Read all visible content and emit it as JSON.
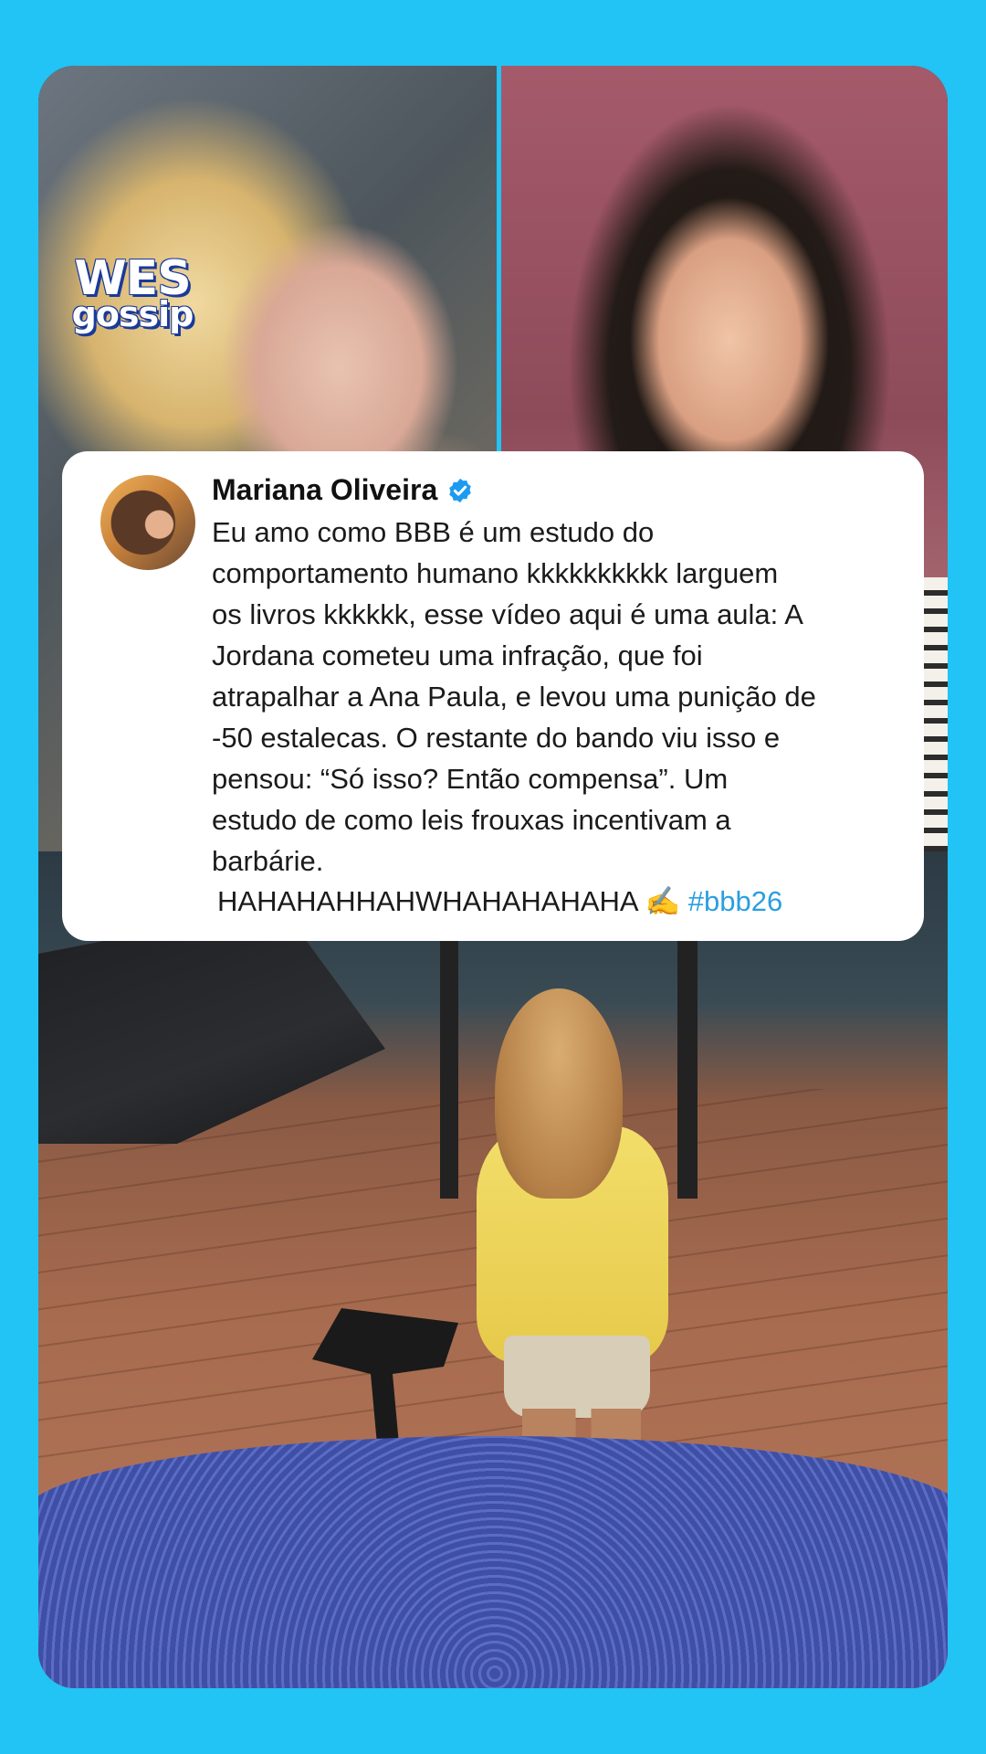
{
  "watermark": {
    "line1": "WES",
    "line2": "gossip"
  },
  "tweet": {
    "author": "Mariana Oliveira",
    "verified": true,
    "body": "Eu amo como BBB é um estudo do\ncomportamento humano kkkkkkkkkk larguem\nos livros kkkkkk, esse vídeo aqui é uma aula: A\nJordana cometeu uma infração, que foi\natrapalhar a Ana Paula, e levou uma punição de\n-50 estalecas. O restante do bando viu isso e\npensou: “Só isso? Então compensa”. Um\nestudo de como leis frouxas incentivam a\nbarbárie.",
    "last_line": "HAHAHAHHAHWHAHAHAHAHA ✍️",
    "hashtag": "#bbb26"
  },
  "colors": {
    "background": "#22c3f5",
    "card": "#ffffff",
    "text": "#1b1b1b",
    "hashtag": "#2a9fe0",
    "verified_badge": "#1d9bf0"
  },
  "icons": {
    "verified": "verified-badge-icon"
  }
}
